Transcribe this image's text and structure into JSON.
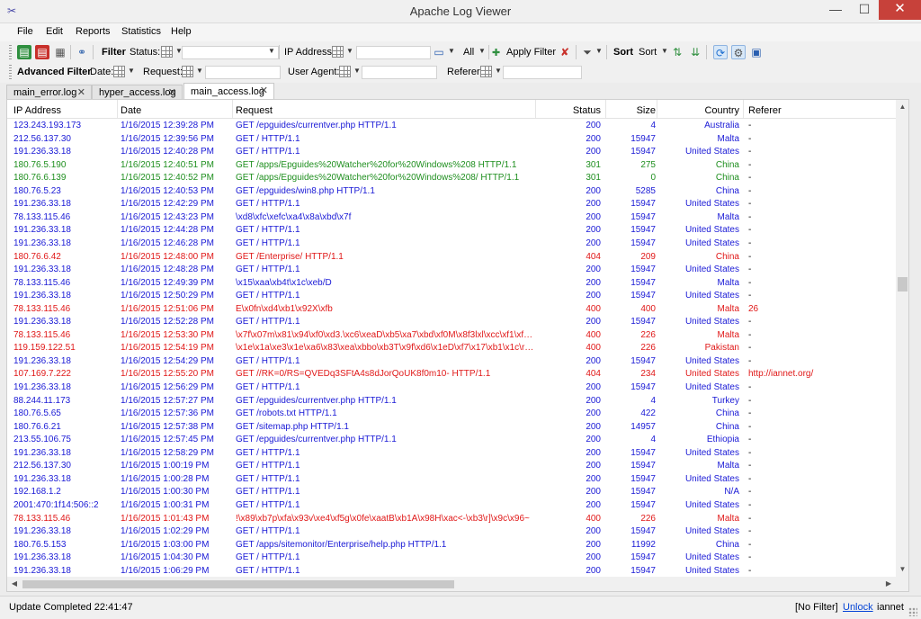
{
  "window": {
    "title": "Apache Log Viewer",
    "minimize": "—",
    "maximize": "☐",
    "close": "✕"
  },
  "menu": [
    "File",
    "Edit",
    "Reports",
    "Statistics",
    "Help"
  ],
  "toolbar": {
    "filter_label": "Filter",
    "status_label": "Status:",
    "ip_label": "IP Address:",
    "all_label": "All",
    "apply_filter": "Apply Filter",
    "sort_label": "Sort",
    "sort_dropdown": "Sort"
  },
  "advanced": {
    "label": "Advanced Filter",
    "date_label": "Date:",
    "request_label": "Request:",
    "user_agent_label": "User Agent:",
    "referer_label": "Referer:"
  },
  "tabs": [
    {
      "label": "main_error.log",
      "active": false
    },
    {
      "label": "hyper_access.log",
      "active": false
    },
    {
      "label": "main_access.log",
      "active": true
    }
  ],
  "columns": [
    "IP Address",
    "Date",
    "Request",
    "Status",
    "Size",
    "Country",
    "Referer"
  ],
  "colors": {
    "ok": "#1a1ad6",
    "redirect": "#1f8f1f",
    "error": "#e01818"
  },
  "rows": [
    {
      "ip": "123.243.193.173",
      "date": "1/16/2015 12:39:28 PM",
      "request": "GET /epguides/currentver.php HTTP/1.1",
      "status": "200",
      "size": "4",
      "country": "Australia",
      "referer": "-",
      "kind": "ok"
    },
    {
      "ip": "212.56.137.30",
      "date": "1/16/2015 12:39:56 PM",
      "request": "GET / HTTP/1.1",
      "status": "200",
      "size": "15947",
      "country": "Malta",
      "referer": "-",
      "kind": "ok"
    },
    {
      "ip": "191.236.33.18",
      "date": "1/16/2015 12:40:28 PM",
      "request": "GET / HTTP/1.1",
      "status": "200",
      "size": "15947",
      "country": "United States",
      "referer": "-",
      "kind": "ok"
    },
    {
      "ip": "180.76.5.190",
      "date": "1/16/2015 12:40:51 PM",
      "request": "GET /apps/Epguides%20Watcher%20for%20Windows%208 HTTP/1.1",
      "status": "301",
      "size": "275",
      "country": "China",
      "referer": "-",
      "kind": "redirect"
    },
    {
      "ip": "180.76.6.139",
      "date": "1/16/2015 12:40:52 PM",
      "request": "GET /apps/Epguides%20Watcher%20for%20Windows%208/ HTTP/1.1",
      "status": "301",
      "size": "0",
      "country": "China",
      "referer": "-",
      "kind": "redirect"
    },
    {
      "ip": "180.76.5.23",
      "date": "1/16/2015 12:40:53 PM",
      "request": "GET /epguides/win8.php HTTP/1.1",
      "status": "200",
      "size": "5285",
      "country": "China",
      "referer": "-",
      "kind": "ok"
    },
    {
      "ip": "191.236.33.18",
      "date": "1/16/2015 12:42:29 PM",
      "request": "GET / HTTP/1.1",
      "status": "200",
      "size": "15947",
      "country": "United States",
      "referer": "-",
      "kind": "ok"
    },
    {
      "ip": "78.133.115.46",
      "date": "1/16/2015 12:43:23 PM",
      "request": "\\xd8\\xfc\\xefc\\xa4\\x8a\\xbd\\x7f",
      "status": "200",
      "size": "15947",
      "country": "Malta",
      "referer": "-",
      "kind": "ok"
    },
    {
      "ip": "191.236.33.18",
      "date": "1/16/2015 12:44:28 PM",
      "request": "GET / HTTP/1.1",
      "status": "200",
      "size": "15947",
      "country": "United States",
      "referer": "-",
      "kind": "ok"
    },
    {
      "ip": "191.236.33.18",
      "date": "1/16/2015 12:46:28 PM",
      "request": "GET / HTTP/1.1",
      "status": "200",
      "size": "15947",
      "country": "United States",
      "referer": "-",
      "kind": "ok"
    },
    {
      "ip": "180.76.6.42",
      "date": "1/16/2015 12:48:00 PM",
      "request": "GET /Enterprise/ HTTP/1.1",
      "status": "404",
      "size": "209",
      "country": "China",
      "referer": "-",
      "kind": "error"
    },
    {
      "ip": "191.236.33.18",
      "date": "1/16/2015 12:48:28 PM",
      "request": "GET / HTTP/1.1",
      "status": "200",
      "size": "15947",
      "country": "United States",
      "referer": "-",
      "kind": "ok"
    },
    {
      "ip": "78.133.115.46",
      "date": "1/16/2015 12:49:39 PM",
      "request": "\\x15\\xaa\\xb4t\\x1c\\xeb/D",
      "status": "200",
      "size": "15947",
      "country": "Malta",
      "referer": "-",
      "kind": "ok"
    },
    {
      "ip": "191.236.33.18",
      "date": "1/16/2015 12:50:29 PM",
      "request": "GET / HTTP/1.1",
      "status": "200",
      "size": "15947",
      "country": "United States",
      "referer": "-",
      "kind": "ok"
    },
    {
      "ip": "78.133.115.46",
      "date": "1/16/2015 12:51:06 PM",
      "request": "E\\x0fn\\xd4\\xb1\\x92X\\xfb",
      "status": "400",
      "size": "400",
      "country": "Malta",
      "referer": "26",
      "kind": "error"
    },
    {
      "ip": "191.236.33.18",
      "date": "1/16/2015 12:52:28 PM",
      "request": "GET / HTTP/1.1",
      "status": "200",
      "size": "15947",
      "country": "United States",
      "referer": "-",
      "kind": "ok"
    },
    {
      "ip": "78.133.115.46",
      "date": "1/16/2015 12:53:30 PM",
      "request": "\\x7f\\x07m\\x81\\x94\\xf0\\xd3.\\xc6\\xeaD\\xb5\\xa7\\xbd\\xf0M\\x8f3lxl\\xcc\\xf1\\xfd...",
      "status": "400",
      "size": "226",
      "country": "Malta",
      "referer": "-",
      "kind": "error"
    },
    {
      "ip": "119.159.122.51",
      "date": "1/16/2015 12:54:19 PM",
      "request": "\\x1e\\x1a\\xe3\\x1e\\xa6\\x83\\xea\\xbbo\\xb3T\\x9f\\xd6\\x1eD\\xf7\\x17\\xb1\\x1c\\r}\\...",
      "status": "400",
      "size": "226",
      "country": "Pakistan",
      "referer": "-",
      "kind": "error"
    },
    {
      "ip": "191.236.33.18",
      "date": "1/16/2015 12:54:29 PM",
      "request": "GET / HTTP/1.1",
      "status": "200",
      "size": "15947",
      "country": "United States",
      "referer": "-",
      "kind": "ok"
    },
    {
      "ip": "107.169.7.222",
      "date": "1/16/2015 12:55:20 PM",
      "request": "GET //RK=0/RS=QVEDq3SFtA4s8dJorQoUK8f0m10- HTTP/1.1",
      "status": "404",
      "size": "234",
      "country": "United States",
      "referer": "http://iannet.org/",
      "kind": "error"
    },
    {
      "ip": "191.236.33.18",
      "date": "1/16/2015 12:56:29 PM",
      "request": "GET / HTTP/1.1",
      "status": "200",
      "size": "15947",
      "country": "United States",
      "referer": "-",
      "kind": "ok"
    },
    {
      "ip": "88.244.11.173",
      "date": "1/16/2015 12:57:27 PM",
      "request": "GET /epguides/currentver.php HTTP/1.1",
      "status": "200",
      "size": "4",
      "country": "Turkey",
      "referer": "-",
      "kind": "ok"
    },
    {
      "ip": "180.76.5.65",
      "date": "1/16/2015 12:57:36 PM",
      "request": "GET /robots.txt HTTP/1.1",
      "status": "200",
      "size": "422",
      "country": "China",
      "referer": "-",
      "kind": "ok"
    },
    {
      "ip": "180.76.6.21",
      "date": "1/16/2015 12:57:38 PM",
      "request": "GET /sitemap.php HTTP/1.1",
      "status": "200",
      "size": "14957",
      "country": "China",
      "referer": "-",
      "kind": "ok"
    },
    {
      "ip": "213.55.106.75",
      "date": "1/16/2015 12:57:45 PM",
      "request": "GET /epguides/currentver.php HTTP/1.1",
      "status": "200",
      "size": "4",
      "country": "Ethiopia",
      "referer": "-",
      "kind": "ok"
    },
    {
      "ip": "191.236.33.18",
      "date": "1/16/2015 12:58:29 PM",
      "request": "GET / HTTP/1.1",
      "status": "200",
      "size": "15947",
      "country": "United States",
      "referer": "-",
      "kind": "ok"
    },
    {
      "ip": "212.56.137.30",
      "date": "1/16/2015 1:00:19 PM",
      "request": "GET / HTTP/1.1",
      "status": "200",
      "size": "15947",
      "country": "Malta",
      "referer": "-",
      "kind": "ok"
    },
    {
      "ip": "191.236.33.18",
      "date": "1/16/2015 1:00:28 PM",
      "request": "GET / HTTP/1.1",
      "status": "200",
      "size": "15947",
      "country": "United States",
      "referer": "-",
      "kind": "ok"
    },
    {
      "ip": "192.168.1.2",
      "date": "1/16/2015 1:00:30 PM",
      "request": "GET / HTTP/1.1",
      "status": "200",
      "size": "15947",
      "country": "N/A",
      "referer": "-",
      "kind": "ok"
    },
    {
      "ip": "2001:470:1f14:506::2",
      "date": "1/16/2015 1:00:31 PM",
      "request": "GET / HTTP/1.1",
      "status": "200",
      "size": "15947",
      "country": "United States",
      "referer": "-",
      "kind": "ok"
    },
    {
      "ip": "78.133.115.46",
      "date": "1/16/2015 1:01:43 PM",
      "request": "!\\x89\\xb7p\\xfa\\x93v\\xe4\\xf5g\\x0fe\\xaatB\\xb1A\\x98H\\xac<-\\xb3\\r]\\x9c\\x96~",
      "status": "400",
      "size": "226",
      "country": "Malta",
      "referer": "-",
      "kind": "error"
    },
    {
      "ip": "191.236.33.18",
      "date": "1/16/2015 1:02:29 PM",
      "request": "GET / HTTP/1.1",
      "status": "200",
      "size": "15947",
      "country": "United States",
      "referer": "-",
      "kind": "ok"
    },
    {
      "ip": "180.76.5.153",
      "date": "1/16/2015 1:03:00 PM",
      "request": "GET /apps/sitemonitor/Enterprise/help.php HTTP/1.1",
      "status": "200",
      "size": "11992",
      "country": "China",
      "referer": "-",
      "kind": "ok"
    },
    {
      "ip": "191.236.33.18",
      "date": "1/16/2015 1:04:30 PM",
      "request": "GET / HTTP/1.1",
      "status": "200",
      "size": "15947",
      "country": "United States",
      "referer": "-",
      "kind": "ok"
    },
    {
      "ip": "191.236.33.18",
      "date": "1/16/2015 1:06:29 PM",
      "request": "GET / HTTP/1.1",
      "status": "200",
      "size": "15947",
      "country": "United States",
      "referer": "-",
      "kind": "ok"
    }
  ],
  "statusbar": {
    "message": "Update Completed 22:41:47",
    "filter": "[No Filter]",
    "unlock": "Unlock",
    "user": "iannet"
  }
}
